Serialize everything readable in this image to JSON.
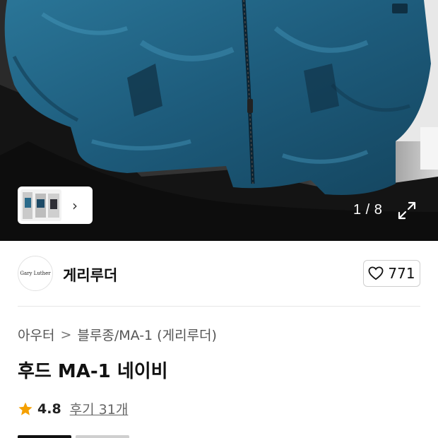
{
  "gallery": {
    "counter": "1 / 8",
    "expand_icon": "expand-icon",
    "thumbnail_arrow": "›"
  },
  "brand": {
    "logo_text": "Gary Luther",
    "name": "게리루더",
    "likes": "771"
  },
  "breadcrumb": {
    "items": [
      "아우터",
      "블루종/MA-1 (게리루더)"
    ],
    "separator": ">"
  },
  "product": {
    "title": "후드 MA-1 네이비",
    "rating": "4.8",
    "reviews": "후기 31개"
  },
  "colors": {
    "jacket": "#1f5f80",
    "star": "#f5a000"
  }
}
